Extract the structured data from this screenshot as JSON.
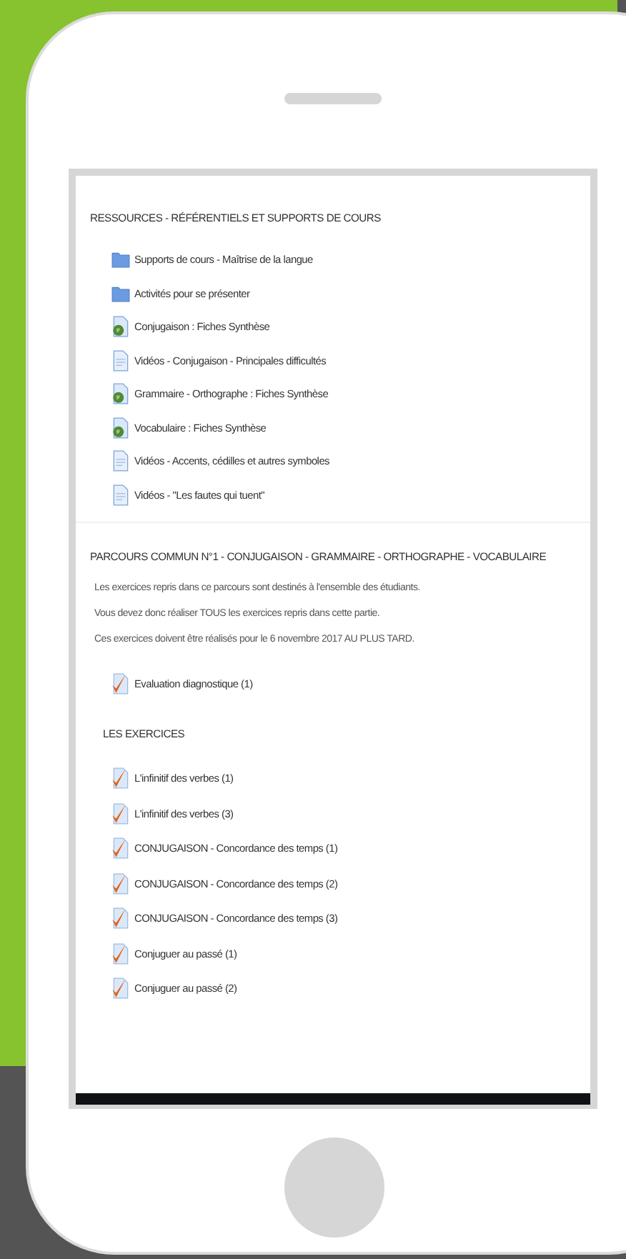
{
  "resources": {
    "title": "RESSOURCES - RÉFÉRENTIELS ET SUPPORTS DE COURS",
    "items": [
      {
        "kind": "folder",
        "label": "Supports de cours - Maîtrise de la langue"
      },
      {
        "kind": "folder",
        "label": "Activités pour se présenter"
      },
      {
        "kind": "url",
        "label": "Conjugaison : Fiches Synthèse"
      },
      {
        "kind": "page",
        "label": "Vidéos - Conjugaison - Principales difficultés"
      },
      {
        "kind": "url",
        "label": "Grammaire - Orthographe : Fiches Synthèse"
      },
      {
        "kind": "url",
        "label": "Vocabulaire : Fiches Synthèse"
      },
      {
        "kind": "page",
        "label": "Vidéos - Accents, cédilles et autres symboles"
      },
      {
        "kind": "page",
        "label": "Vidéos - \"Les fautes qui tuent\""
      }
    ]
  },
  "parcours": {
    "title": "PARCOURS COMMUN N°1 - CONJUGAISON - GRAMMAIRE - ORTHOGRAPHE - VOCABULAIRE",
    "paragraphs": [
      "Les exercices repris dans ce parcours sont destinés à l'ensemble des étudiants.",
      "Vous devez donc réaliser TOUS les exercices repris dans cette partie.",
      "Ces exercices doivent être réalisés pour le 6 novembre 2017 AU PLUS TARD."
    ],
    "diagnostic": [
      {
        "label": "Evaluation diagnostique (1)",
        "completed": true
      }
    ],
    "subheading": "LES EXERCICES",
    "exercises": [
      {
        "label": "L'infinitif des verbes (1)",
        "completed": true
      },
      {
        "label": "L'infinitif des verbes (3)",
        "completed": true
      },
      {
        "label": "CONJUGAISON - Concordance des temps (1)",
        "completed": true
      },
      {
        "label": "CONJUGAISON - Concordance des temps (2)",
        "completed": true
      },
      {
        "label": "CONJUGAISON - Concordance des temps (3)",
        "completed": true
      },
      {
        "label": "Conjuguer au passé (1)",
        "completed": true
      },
      {
        "label": "Conjuguer au passé (2)",
        "completed": true
      }
    ]
  }
}
